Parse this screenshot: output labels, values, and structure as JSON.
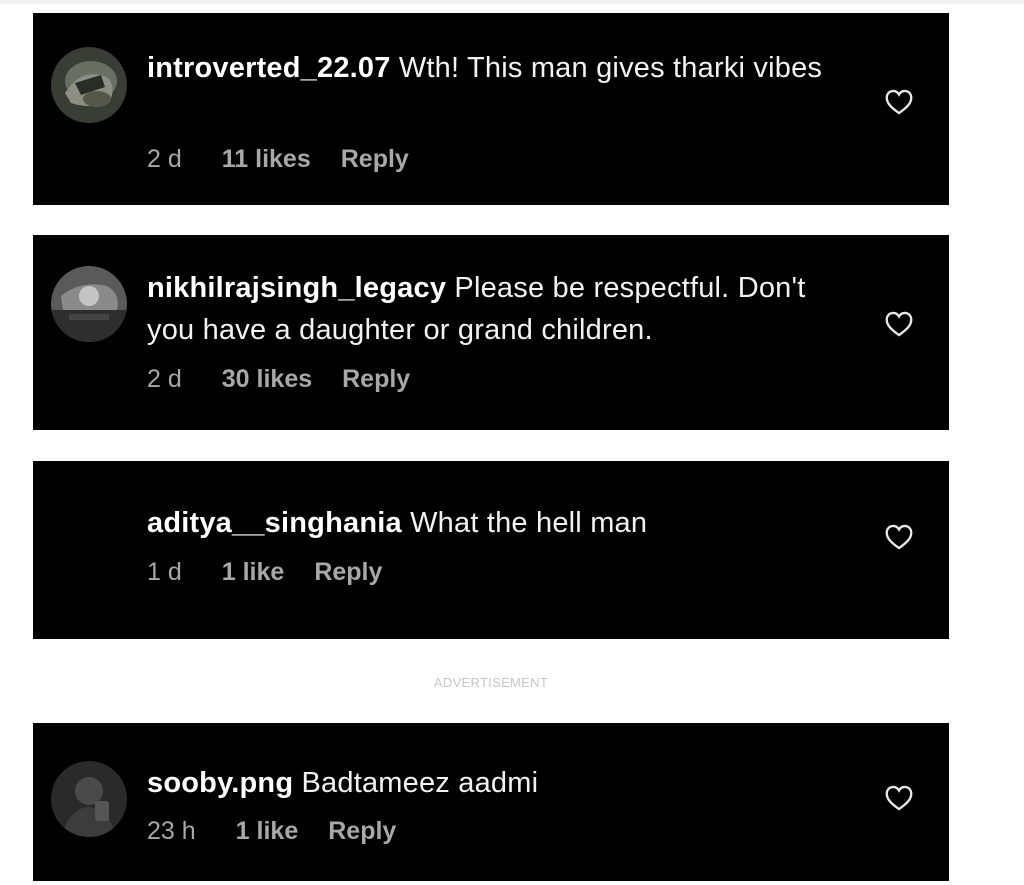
{
  "comments": [
    {
      "username": "introverted_22.07",
      "text": " Wth! This man gives tharki vibes",
      "time": "2 d",
      "likes": "11 likes",
      "reply": "Reply",
      "has_avatar": true
    },
    {
      "username": "nikhilrajsingh_legacy",
      "text": " Please be respectful. Don't you have a daughter or grand children.",
      "time": "2 d",
      "likes": "30 likes",
      "reply": "Reply",
      "has_avatar": true
    },
    {
      "username": "aditya__singhania",
      "text": " What the hell man",
      "time": "1 d",
      "likes": "1 like",
      "reply": "Reply",
      "has_avatar": false
    },
    {
      "username": "sooby.png",
      "text": " Badtameez aadmi",
      "time": "23 h",
      "likes": "1 like",
      "reply": "Reply",
      "has_avatar": true
    }
  ],
  "advertisement_label": "ADVERTISEMENT",
  "icons": {
    "like": "heart-outline-icon"
  },
  "colors": {
    "card_background": "#000000",
    "meta_text": "#a8a8a8",
    "username": "#ffffff"
  }
}
